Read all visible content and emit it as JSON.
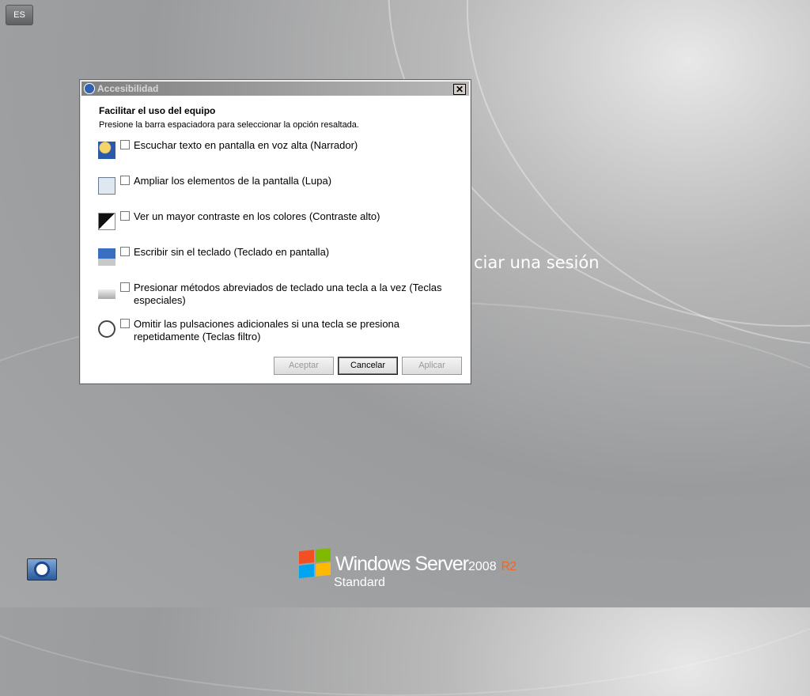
{
  "language_button": "ES",
  "signin_text": "ciar una sesión",
  "logo": {
    "brand": "Windows Server",
    "year": "2008",
    "release": "R2",
    "edition": "Standard"
  },
  "dialog": {
    "title": "Accesibilidad",
    "heading": "Facilitar el uso del equipo",
    "instruction": "Presione la barra espaciadora para seleccionar la opción resaltada.",
    "options": [
      {
        "label": "Escuchar texto en pantalla en voz alta (Narrador)",
        "checked": false,
        "icon": "narrator-icon"
      },
      {
        "label": "Ampliar los elementos de la pantalla (Lupa)",
        "checked": false,
        "icon": "magnifier-icon"
      },
      {
        "label": "Ver un mayor contraste en los colores (Contraste alto)",
        "checked": false,
        "icon": "high-contrast-icon"
      },
      {
        "label": "Escribir sin el teclado (Teclado en pantalla)",
        "checked": false,
        "icon": "onscreen-keyboard-icon"
      },
      {
        "label": "Presionar métodos abreviados de teclado una tecla a la vez (Teclas especiales)",
        "checked": false,
        "icon": "sticky-keys-icon"
      },
      {
        "label": "Omitir las pulsaciones adicionales si una tecla se presiona repetidamente (Teclas filtro)",
        "checked": false,
        "icon": "filter-keys-icon"
      }
    ],
    "buttons": {
      "ok": "Aceptar",
      "cancel": "Cancelar",
      "apply": "Aplicar"
    }
  }
}
